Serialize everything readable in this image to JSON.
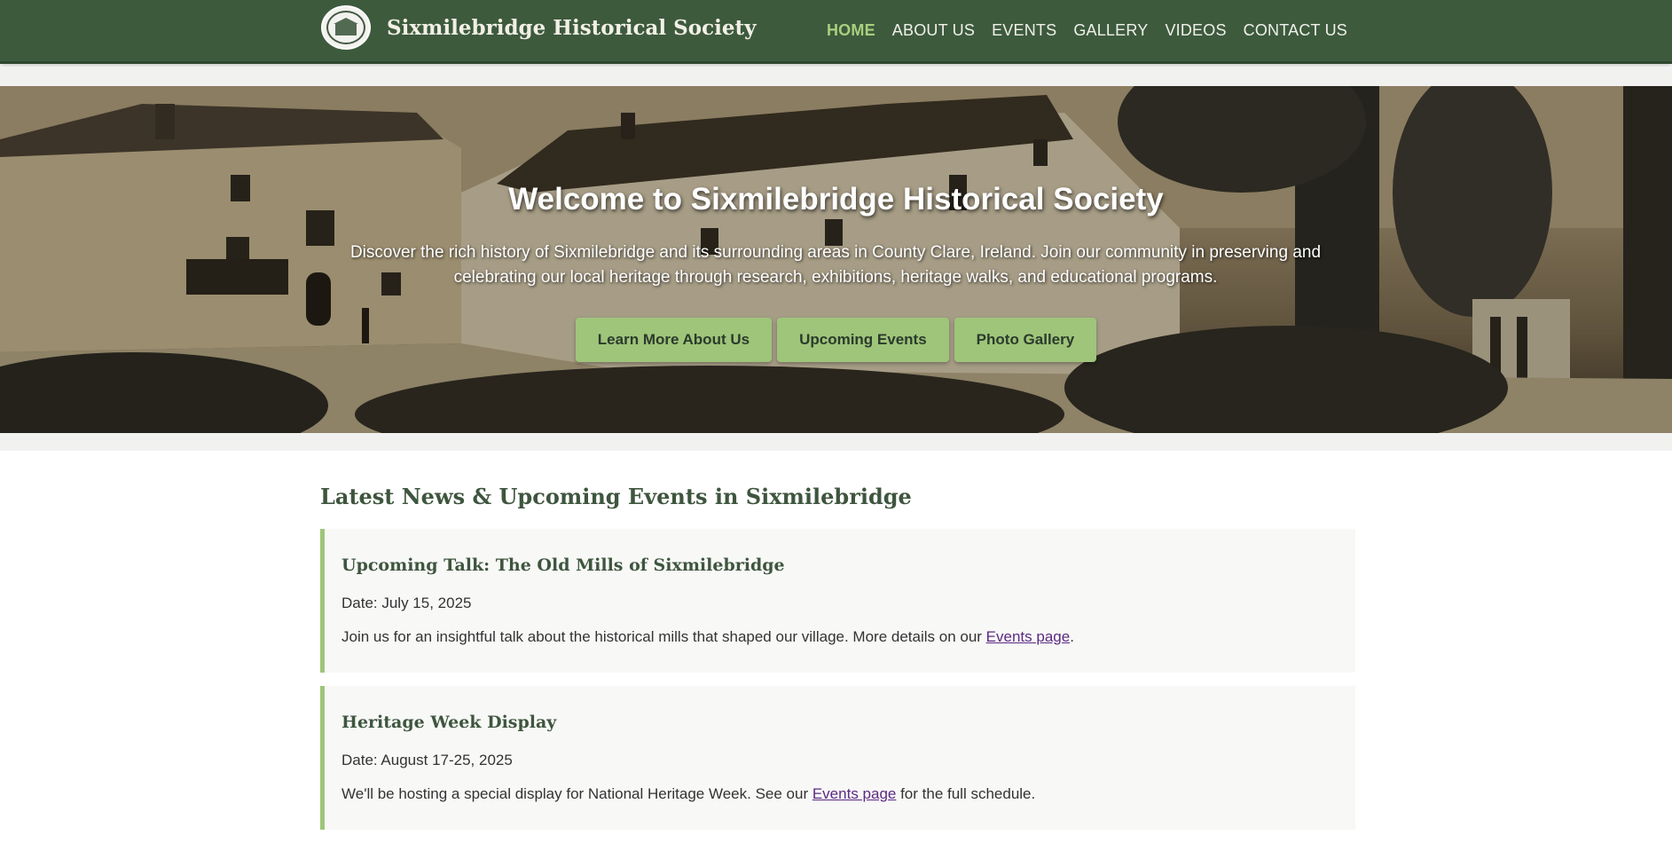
{
  "header": {
    "site_title": "Sixmilebridge Historical Society",
    "logo_icon": "society-seal-icon",
    "nav": [
      {
        "label": "HOME",
        "active": true
      },
      {
        "label": "ABOUT US",
        "active": false
      },
      {
        "label": "EVENTS",
        "active": false
      },
      {
        "label": "GALLERY",
        "active": false
      },
      {
        "label": "VIDEOS",
        "active": false
      },
      {
        "label": "CONTACT US",
        "active": false
      }
    ]
  },
  "hero": {
    "title": "Welcome to Sixmilebridge Historical Society",
    "text": "Discover the rich history of Sixmilebridge and its surrounding areas in County Clare, Ireland. Join our community in preserving and celebrating our local heritage through research, exhibitions, heritage walks, and educational programs.",
    "buttons": [
      "Learn More About Us",
      "Upcoming Events",
      "Photo Gallery"
    ]
  },
  "news": {
    "title": "Latest News & Upcoming Events in Sixmilebridge",
    "items": [
      {
        "title": "Upcoming Talk: The Old Mills of Sixmilebridge",
        "date": "Date: July 15, 2025",
        "desc_before": "Join us for an insightful talk about the historical mills that shaped our village. More details on our ",
        "link": "Events page",
        "desc_after": "."
      },
      {
        "title": "Heritage Week Display",
        "date": "Date: August 17-25, 2025",
        "desc_before": "We'll be hosting a special display for National Heritage Week. See our ",
        "link": "Events page",
        "desc_after": " for the full schedule."
      }
    ]
  },
  "colors": {
    "header_bg": "#3d5a3d",
    "accent_green": "#9ec57a",
    "nav_active": "#a9cf7e",
    "heading_green": "#3e553e",
    "link_purple": "#5b2a82"
  }
}
